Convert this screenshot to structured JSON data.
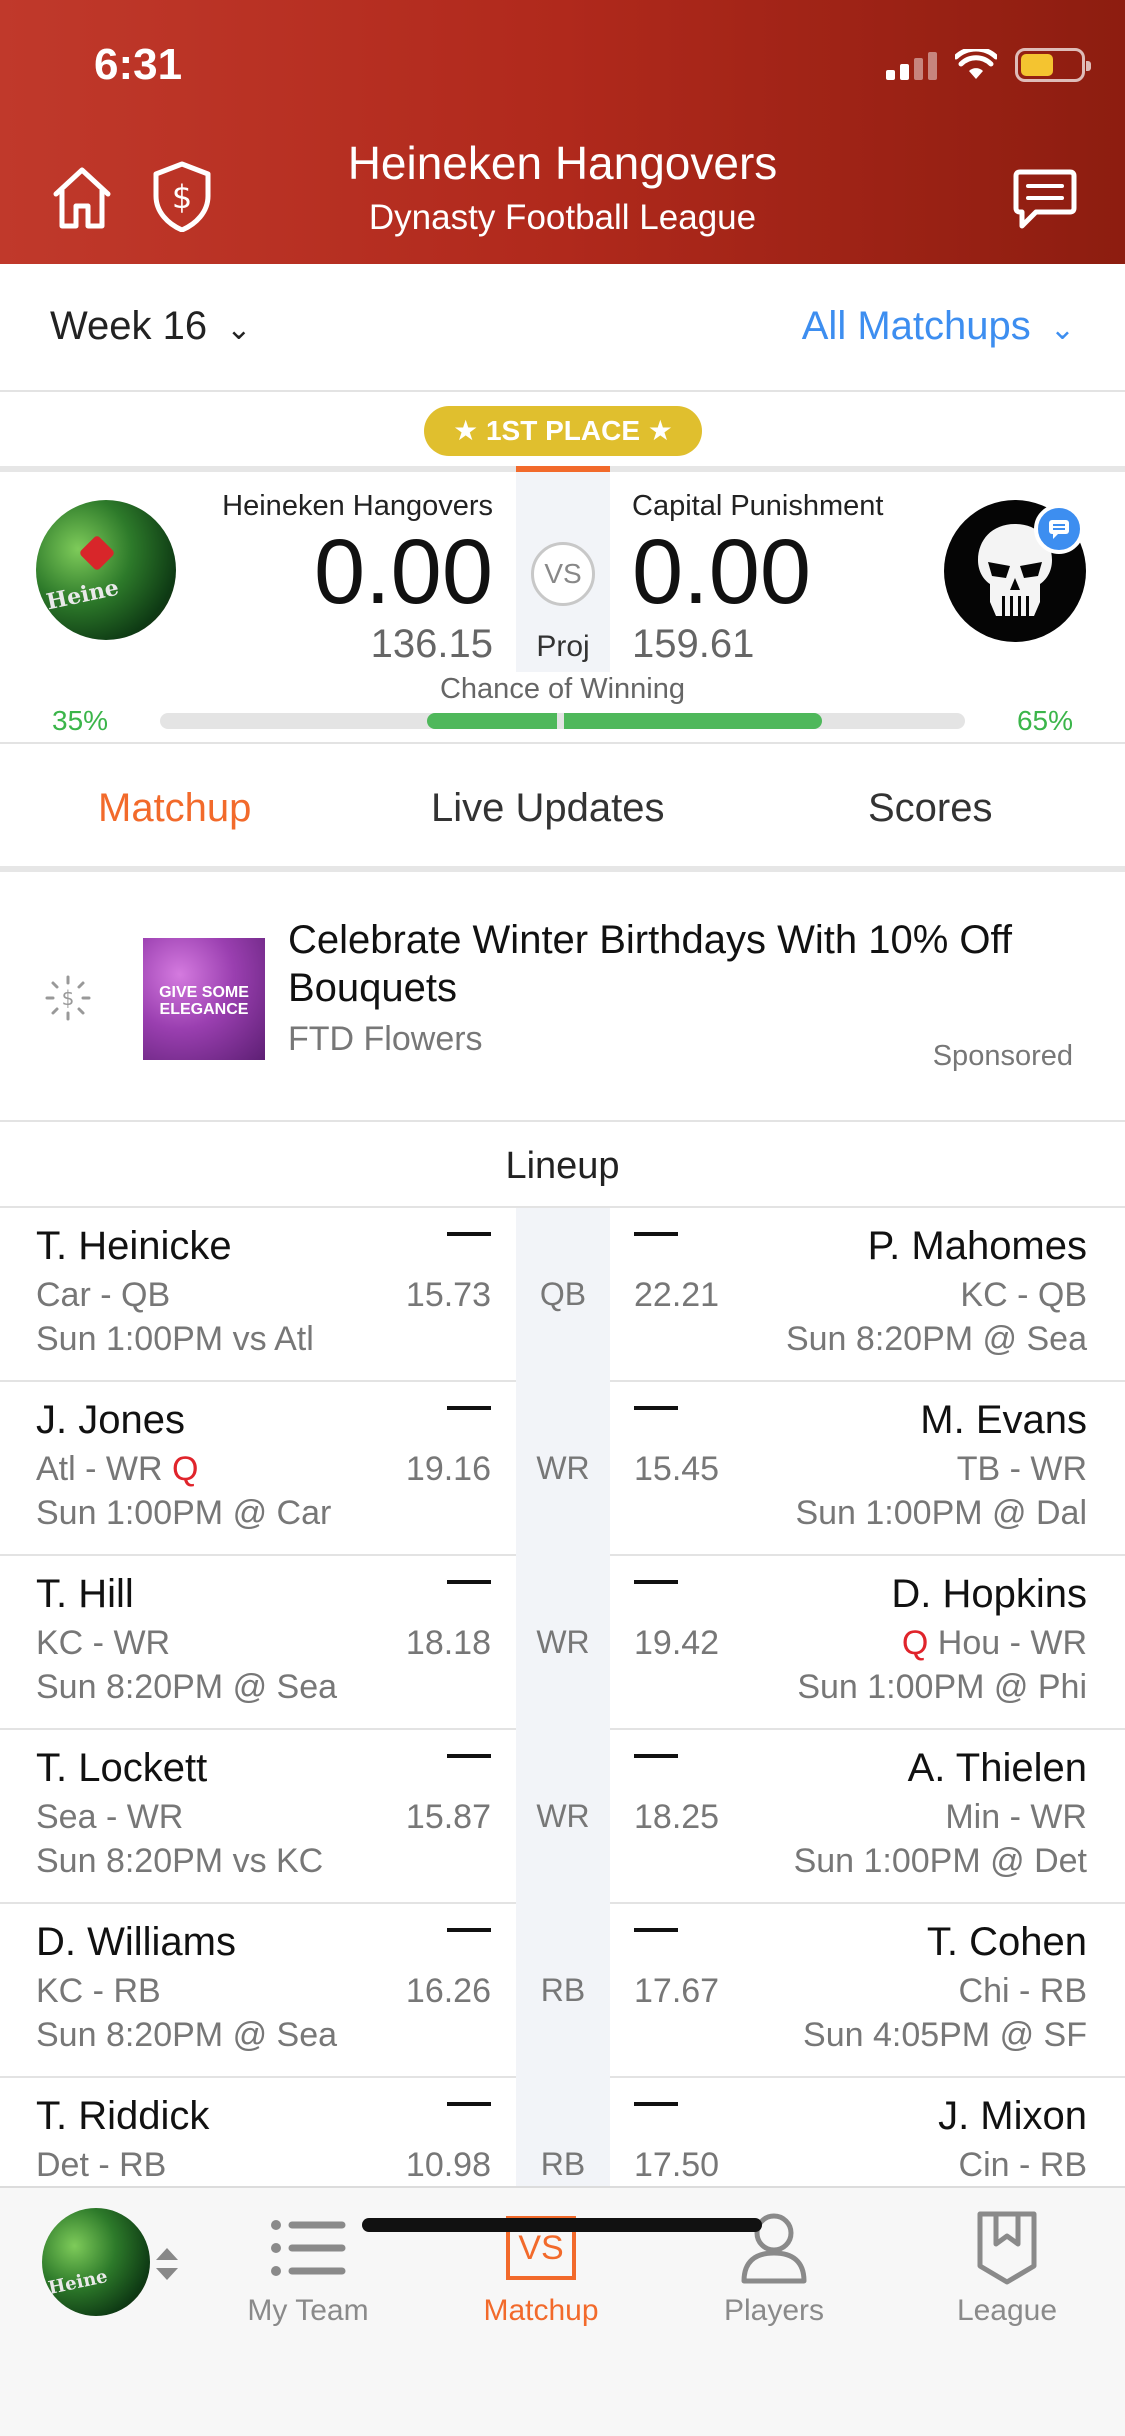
{
  "status": {
    "time": "6:31"
  },
  "header": {
    "title": "Heineken Hangovers",
    "subtitle": "Dynasty Football League",
    "icons": [
      "home-icon",
      "shield-dollar-icon",
      "chat-icon"
    ]
  },
  "week": {
    "label": "Week 16",
    "all_matchups": "All Matchups"
  },
  "badge": "★ 1ST PLACE ★",
  "matchup": {
    "left": {
      "name": "Heineken Hangovers",
      "score": "0.00",
      "proj": "136.15",
      "win_pct": "35%",
      "avatar_text": "Heine"
    },
    "right": {
      "name": "Capital Punishment",
      "score": "0.00",
      "proj": "159.61",
      "win_pct": "65%"
    },
    "vs": "VS",
    "proj_label": "Proj",
    "chance_label": "Chance of Winning",
    "win_fraction_left": 0.35
  },
  "tabs": [
    "Matchup",
    "Live Updates",
    "Scores"
  ],
  "ad": {
    "title": "Celebrate Winter Birthdays With 10% Off Bouquets",
    "brand": "FTD Flowers",
    "sponsored": "Sponsored",
    "image_text": "GIVE SOME ELEGANCE"
  },
  "lineup": {
    "title": "Lineup",
    "rows": [
      {
        "pos": "QB",
        "left": {
          "name": "T. Heinicke",
          "team": "Car - QB",
          "game": "Sun 1:00PM vs Atl",
          "proj": "15.73",
          "flag": ""
        },
        "right": {
          "name": "P. Mahomes",
          "team": "KC - QB",
          "game": "Sun 8:20PM @ Sea",
          "proj": "22.21",
          "flag": ""
        }
      },
      {
        "pos": "WR",
        "left": {
          "name": "J. Jones",
          "team": "Atl - WR",
          "game": "Sun 1:00PM @ Car",
          "proj": "19.16",
          "flag": "Q"
        },
        "right": {
          "name": "M. Evans",
          "team": "TB - WR",
          "game": "Sun 1:00PM @ Dal",
          "proj": "15.45",
          "flag": ""
        }
      },
      {
        "pos": "WR",
        "left": {
          "name": "T. Hill",
          "team": "KC - WR",
          "game": "Sun 8:20PM @ Sea",
          "proj": "18.18",
          "flag": ""
        },
        "right": {
          "name": "D. Hopkins",
          "team": "Hou - WR",
          "game": "Sun 1:00PM @ Phi",
          "proj": "19.42",
          "flag": "Q"
        }
      },
      {
        "pos": "WR",
        "left": {
          "name": "T. Lockett",
          "team": "Sea - WR",
          "game": "Sun 8:20PM vs KC",
          "proj": "15.87",
          "flag": ""
        },
        "right": {
          "name": "A. Thielen",
          "team": "Min - WR",
          "game": "Sun 1:00PM @ Det",
          "proj": "18.25",
          "flag": ""
        }
      },
      {
        "pos": "RB",
        "left": {
          "name": "D. Williams",
          "team": "KC - RB",
          "game": "Sun 8:20PM @ Sea",
          "proj": "16.26",
          "flag": ""
        },
        "right": {
          "name": "T. Cohen",
          "team": "Chi - RB",
          "game": "Sun 4:05PM @ SF",
          "proj": "17.67",
          "flag": ""
        }
      },
      {
        "pos": "RB",
        "left": {
          "name": "T. Riddick",
          "team": "Det - RB",
          "game": "",
          "proj": "10.98",
          "flag": ""
        },
        "right": {
          "name": "J. Mixon",
          "team": "Cin - RB",
          "game": "",
          "proj": "17.50",
          "flag": ""
        }
      }
    ]
  },
  "bottom_nav": {
    "items": [
      {
        "label": "My Team",
        "icon": "list-icon"
      },
      {
        "label": "Matchup",
        "icon": "vs-icon",
        "active": true
      },
      {
        "label": "Players",
        "icon": "person-icon"
      },
      {
        "label": "League",
        "icon": "bookmark-shield-icon"
      }
    ],
    "vs_text": "VS"
  },
  "colors": {
    "header": "#b0291c",
    "accent": "#f26a2b",
    "link": "#3d8ef0",
    "win": "#4fb85b",
    "badge": "#e0bf2e",
    "question": "#e0242b"
  }
}
